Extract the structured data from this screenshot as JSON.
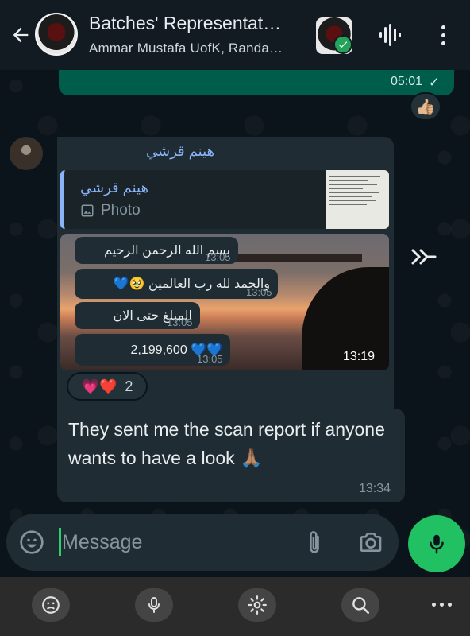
{
  "header": {
    "title": "Batches' Representat…",
    "subtitle": "Ammar Mustafa UofK, Randa…",
    "back_icon": "arrow-left-icon",
    "audio_icon": "voice-chat-waveform-icon",
    "menu_icon": "more-vertical-icon"
  },
  "messages": {
    "outgoing_time": "05:01",
    "outgoing_tick": "✓",
    "outgoing_reaction": "👍🏼",
    "incoming1": {
      "sender": "هينم قرشي",
      "quoted_sender": "هينم قرشي",
      "quoted_type": "Photo",
      "chips": [
        {
          "text": "بسم الله الرحمن الرحيم",
          "time": "13:05"
        },
        {
          "text": "والحمد لله رب العالمين 🥹💙",
          "time": "13:05"
        },
        {
          "text": "المبلغ حتى الان",
          "time": "13:05"
        },
        {
          "text": "2,199,600 💙💙",
          "time": "13:05"
        }
      ],
      "time": "13:19",
      "reactions": "💗❤️",
      "reaction_count": "2"
    },
    "incoming2": {
      "text": "They sent me the scan report if anyone wants to have a look 🙏🏽",
      "time": "13:34"
    }
  },
  "composer": {
    "placeholder": "Message"
  },
  "colors": {
    "outgoing_bubble": "#005c4b",
    "incoming_bubble": "#202c33",
    "accent_green": "#21c063",
    "sender_name": "#8ab4f8"
  }
}
